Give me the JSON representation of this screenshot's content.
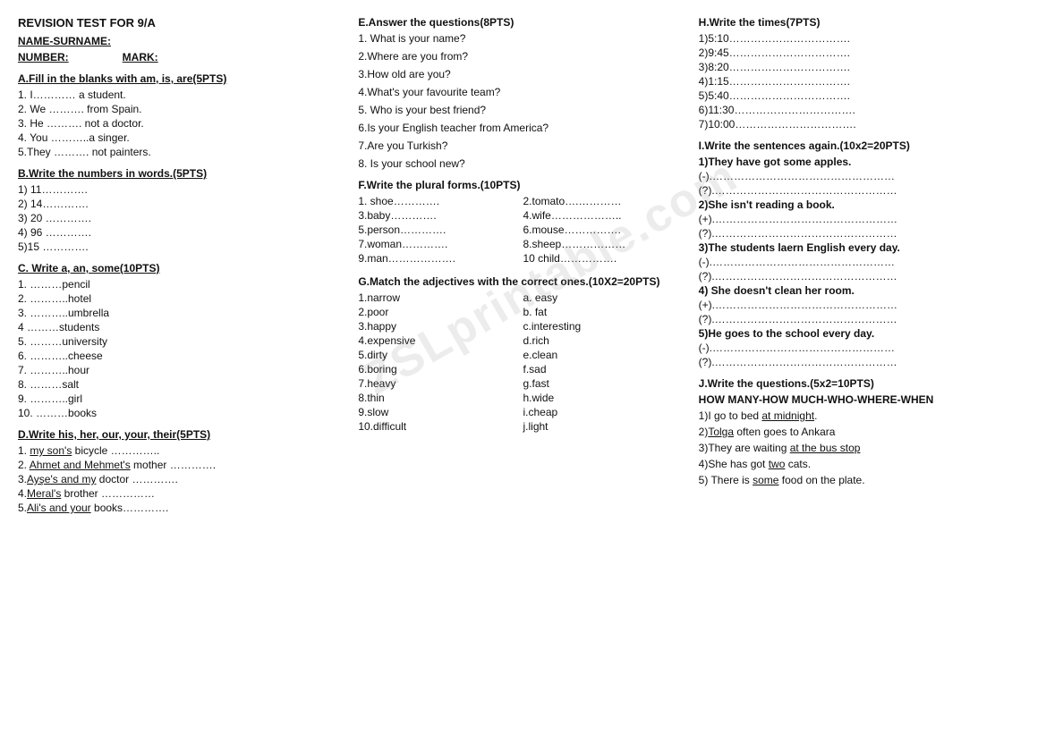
{
  "page": {
    "title": "REVISION TEST FOR 9/A",
    "name_label": "NAME-SURNAME:",
    "number_label": "NUMBER:",
    "mark_label": "MARK:",
    "sections": {
      "A": {
        "title": "A.Fill in the blanks with am, is, are(5PTS)",
        "items": [
          "1. I………… a student.",
          "2. We ………. from Spain.",
          "3. He ………. not a doctor.",
          "4. You ………..a singer.",
          "5.They ………. not painters."
        ]
      },
      "B": {
        "title": "B.Write the numbers in words.(5PTS)",
        "items": [
          "1) 11………….",
          "2) 14………….",
          "3) 20 ………….",
          "4) 96 ………….",
          "5)15 …………."
        ]
      },
      "C": {
        "title": "C. Write a, an, some(10PTS)",
        "items": [
          "1. ………pencil",
          "2. ………..hotel",
          "3. ………..umbrella",
          "4 ………students",
          "5. ………university",
          "6. ………..cheese",
          "7. ………..hour",
          "8. ………salt",
          "9. ………..girl",
          "10. ………books"
        ]
      },
      "D": {
        "title": "D.Write his, her, our, your, their(5PTS)",
        "items": [
          "1. my son's bicycle …………..",
          "2. Ahmet and Mehmet's mother …………..",
          "3.Ayşe's and my doctor ………….",
          "4.Meral's brother ……………",
          "5.Ali's and your books…………."
        ]
      },
      "E": {
        "title": "E.Answer the questions(8PTS)",
        "items": [
          "1. What is your name?",
          "2.Where are you from?",
          "3.How old are you?",
          "4.What's your favourite team?",
          "5. Who is your best friend?",
          "6.Is your English teacher from America?",
          "7.Are you Turkish?",
          "8. Is your school new?"
        ]
      },
      "F": {
        "title": "F.Write the plural forms.(10PTS)",
        "items_left": [
          "1. shoe………….",
          "3.baby………….",
          "5.person………….",
          "7.woman………….",
          "9.man………………."
        ],
        "items_right": [
          "2.tomato….…………",
          "4.wife………………..",
          "6.mouse……………..",
          "8.sheep………………",
          "10 child……………."
        ]
      },
      "G": {
        "title": "G.Match the adjectives with the correct ones.(10X2=20PTS)",
        "left": [
          "1.narrow",
          "2.poor",
          "3.happy",
          "4.expensive",
          "5.dirty",
          "6.boring",
          "7.heavy",
          "8.thin",
          "9.slow",
          "10.difficult"
        ],
        "right": [
          "a. easy",
          "b. fat",
          "c.interesting",
          "d.rich",
          "e.clean",
          "f.sad",
          "g.fast",
          "h.wide",
          "i.cheap",
          "j.light"
        ]
      },
      "H": {
        "title": "H.Write the times(7PTS)",
        "items": [
          "1)5:10…………………………….",
          "2)9:45……………………………..",
          "3)8:20……………………………..",
          "4)1:15……………………………..",
          "5)5:40……………………………..",
          "6)11:30……………………………..",
          "7)10:00……………………………."
        ]
      },
      "I": {
        "title": "I.Write the sentences again.(10x2=20PTS)",
        "items": [
          {
            "sentence": "1)They have got some apples.",
            "neg": "(-).……………………………………………………",
            "q": "(?).…………………………………………………"
          },
          {
            "sentence": "2)She isn't reading a book.",
            "pos": "(+).……………………………………………………",
            "q": "(?).…………………………………………………"
          },
          {
            "sentence": "3)The students laern English every day.",
            "neg": "(-).……………………………………………………",
            "q": "(?).…………………………………………………"
          },
          {
            "sentence": "4) She doesn't clean her room.",
            "pos": "(+).……………………………………………………",
            "q": "(?).…………………………………………………"
          },
          {
            "sentence": "5)He goes to the school every day.",
            "neg": "(-).……………………………………………………",
            "q": "(?).…………………………………………………"
          }
        ]
      },
      "J": {
        "title": "J.Write the questions.(5x2=10PTS)",
        "subtitle": "HOW MANY-HOW MUCH-WHO-WHERE-WHEN",
        "items": [
          "1)I go to bed at midnight.",
          "2)Tolga often goes to Ankara",
          "3)They are waiting at the bus stop",
          "4)She has got two cats.",
          "5) There is some food on the plate."
        ],
        "underlines": {
          "1": "at midnight",
          "2": "Tolga",
          "3": "at the bus stop",
          "4": "two",
          "5": "some"
        }
      }
    }
  },
  "watermark": "ZSLprintable.com"
}
